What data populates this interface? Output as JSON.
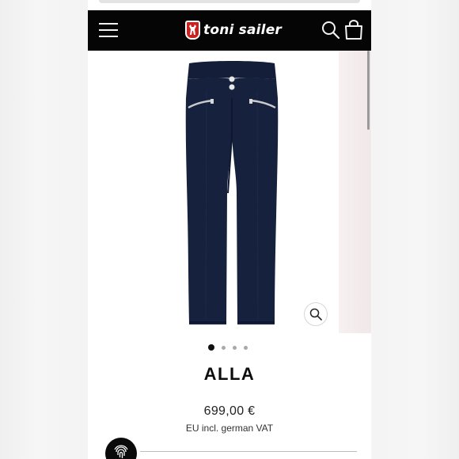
{
  "header": {
    "brand": "toni sailer",
    "menu_icon": "hamburger-menu-icon",
    "search_icon": "search-icon",
    "cart_icon": "shopping-bag-icon",
    "background": "#050505"
  },
  "gallery": {
    "image": "navy-ski-pants-product-image",
    "pants_color": "#16213d",
    "zoom_icon": "magnifier-icon",
    "slide_count": 4,
    "active_slide": 1
  },
  "product": {
    "name": "ALLA",
    "price": "699,00 €",
    "vat_note": "EU incl. german VAT"
  },
  "widgets": {
    "fingerprint_icon": "fingerprint-icon"
  }
}
